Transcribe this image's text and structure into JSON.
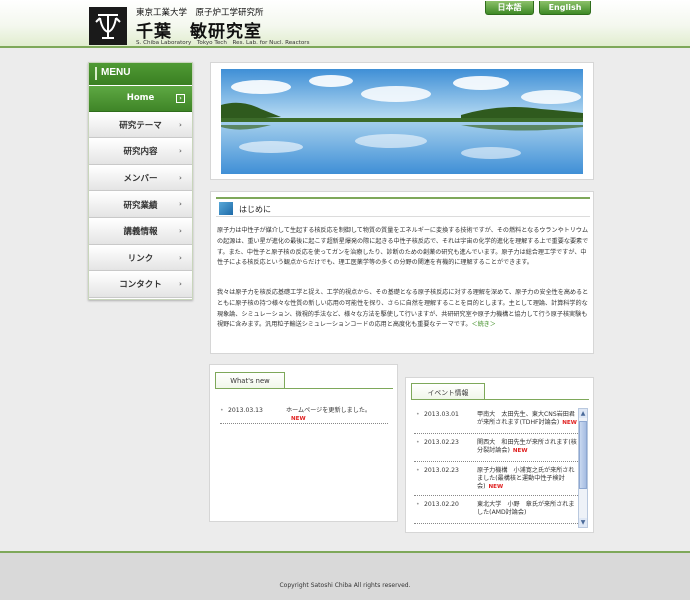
{
  "header": {
    "university_line": "東京工業大学　原子炉工学研究所",
    "lab_name": "千葉　敏研究室",
    "lab_name_en": "S. Chiba Laboratory　Tokyo Tech　Res. Lab. for Nucl. Reactors",
    "lang_ja": "日本語",
    "lang_en": "English"
  },
  "sidebar": {
    "title": "MENU",
    "items": [
      {
        "label": "Home"
      },
      {
        "label": "研究テーマ"
      },
      {
        "label": "研究内容"
      },
      {
        "label": "メンバー"
      },
      {
        "label": "研究業績"
      },
      {
        "label": "講義情報"
      },
      {
        "label": "リンク"
      },
      {
        "label": "コンタクト"
      }
    ]
  },
  "intro": {
    "title": "はじめに",
    "para1": "原子力は中性子が媒介して生起する核反応を制御して物質の質量をエネルギーに変換する技術ですが、その燃料となるウランやトリウムの起源は、重い星が進化の最後に起こす超新星爆発の際に起きる中性子核反応で、それは宇宙の化学的進化を理解する上で重要な要素です。また、中性子と原子核の反応を使ってガンを治療したり、診断のための創薬の研究も進んでいます。原子力は総合理工学ですが、中性子による核反応という観点からだけでも、理工医薬学等の多くの分野の関連を有機的に理解することができます。",
    "para2": "我々は原子力を核反応基礎工学と捉え、工学的視点から、その基礎となる原子核反応に対する理解を深めて、原子力の安全性を高めるとともに原子核の持つ様々な性質の新しい応用の可能性を探り、さらに自然を理解することを目的とします。主として理論、計算科学的な現象論、シミュレーション、微視的手法など、様々な方法を駆使して行いますが、共研研究室や原子力機構と協力して行う原子核実験も視野に含みます。汎用粒子輸送シミュレーションコードの応用と高度化も重要なテーマです。",
    "more": "＜続き＞"
  },
  "news": {
    "title": "What's new",
    "items": [
      {
        "date": "2013.03.13",
        "text": "ホームページを更新しました。",
        "badge": "NEW"
      }
    ]
  },
  "events": {
    "title": "イベント情報",
    "items": [
      {
        "date": "2013.03.01",
        "text": "甲南大　太田先生、東大CNS岩田君が来所されます(TDHF討論会)",
        "badge": "NEW"
      },
      {
        "date": "2013.02.23",
        "text": "関西大　和田先生が来所されます(核分裂討論会)",
        "badge": "NEW"
      },
      {
        "date": "2013.02.23",
        "text": "原子力機構　小浦寛之氏が来所されました(最構核と運動中性子検討会)",
        "badge": "NEW"
      },
      {
        "date": "2013.02.20",
        "text": "東北大学　小野　章氏が来所されました(AMD討論会)",
        "badge": ""
      }
    ]
  },
  "footer": {
    "copyright": "Copyright Satoshi Chiba All rights reserved."
  },
  "colors": {
    "accent_green": "#4f9a34",
    "new_red": "#e02020",
    "background": "#ececec"
  }
}
